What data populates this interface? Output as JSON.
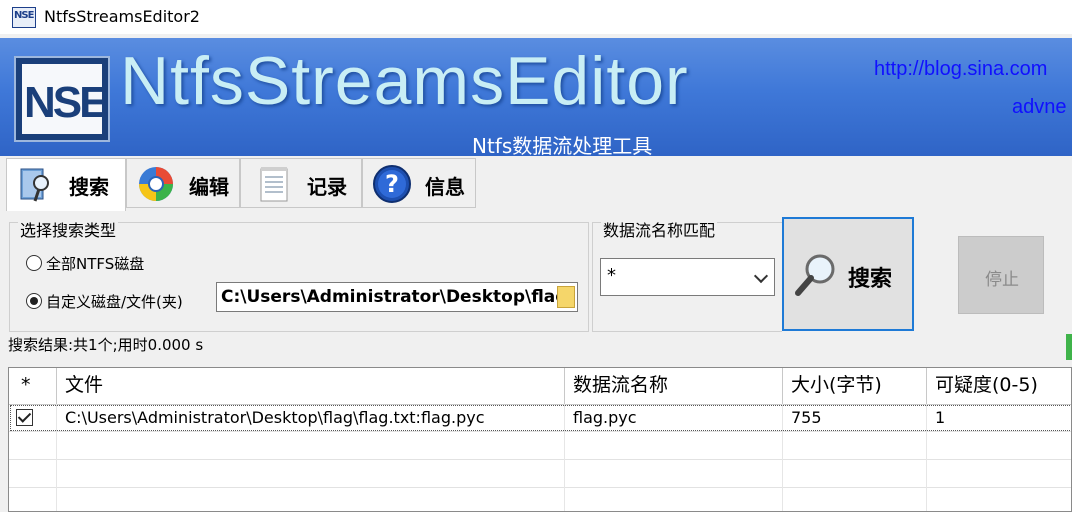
{
  "window": {
    "title": "NtfsStreamsEditor2",
    "icon_text": "NSE"
  },
  "banner": {
    "logo_text": "NSE",
    "app_name": "NtfsStreamsEditor",
    "subtitle": "Ntfs数据流处理工具",
    "url": "http://blog.sina.com",
    "url_line2": "advne"
  },
  "tabs": [
    {
      "label": "搜索",
      "icon": "search-tab-icon",
      "active": true
    },
    {
      "label": "编辑",
      "icon": "edit-globe-icon",
      "active": false
    },
    {
      "label": "记录",
      "icon": "notepad-icon",
      "active": false
    },
    {
      "label": "信息",
      "icon": "help-icon",
      "active": false
    }
  ],
  "search_type": {
    "legend": "选择搜索类型",
    "options": [
      {
        "label": "全部NTFS磁盘",
        "selected": false
      },
      {
        "label": "自定义磁盘/文件(夹)",
        "selected": true
      }
    ],
    "path_value": "C:\\Users\\Administrator\\Desktop\\flag"
  },
  "stream_match": {
    "legend": "数据流名称匹配",
    "value": "*"
  },
  "buttons": {
    "search": "搜索",
    "stop": "停止"
  },
  "status": "搜索结果:共1个;用时0.000 s",
  "table": {
    "headers": [
      "*",
      "文件",
      "数据流名称",
      "大小(字节)",
      "可疑度(0-5)"
    ],
    "rows": [
      {
        "checked": true,
        "file": "C:\\Users\\Administrator\\Desktop\\flag\\flag.txt:flag.pyc",
        "stream": "flag.pyc",
        "size": "755",
        "suspicion": "1"
      }
    ]
  }
}
